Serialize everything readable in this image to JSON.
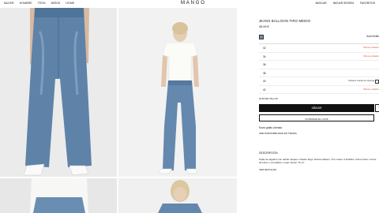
{
  "nav": {
    "left": [
      "Mujer",
      "Hombre",
      "Teen",
      "Niños",
      "Home"
    ],
    "logo": "MANGO",
    "right": [
      "Buscar",
      "Iniciar sesión",
      "Favoritos"
    ]
  },
  "product": {
    "title": "JEANS BALLOON TIRO MEDIO",
    "price": "45,99 €",
    "color_name": "Azul medio",
    "swatch_color": "#6e8fb3",
    "sizes": [
      {
        "size": "32",
        "note": "Últimas unidades"
      },
      {
        "size": "34",
        "note": "Últimas unidades"
      },
      {
        "size": "36",
        "note": ""
      },
      {
        "size": "38",
        "note": ""
      },
      {
        "size": "40",
        "note": "Avísame cuando se reponga"
      },
      {
        "size": "42",
        "note": "Últimas unidades"
      }
    ],
    "size_guide": "Guía de tallas",
    "add_button": "Añadir",
    "look_button": "Consigue el look",
    "shipping": "Envío gratis a tienda",
    "store_link": "Ver disponibilidad en tienda",
    "description_heading": "Descripción",
    "description": "Tejido de algodón con teñido vaquero. Diseño largo. Diseño balloon. Tiro medio. 5 bolsillos. Cierre botón. Cierre de botón y cremallera. Largo interior 76 cm.",
    "details_link": "Ver detalles"
  }
}
